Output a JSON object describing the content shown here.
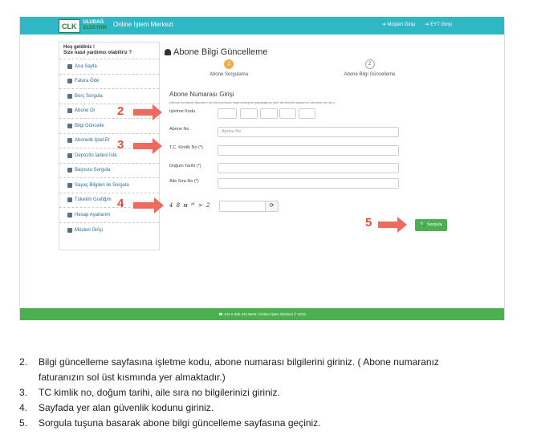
{
  "header": {
    "logo_short": "CLK",
    "logo_line1": "ULUDAĞ",
    "logo_line2": "ELEKTRİK",
    "site_title": "Online İşlem Merkezi",
    "link_customer": "Müşteri Girişi",
    "link_eyt": "EYT Girişi"
  },
  "sidebar": {
    "greeting": "Hoş geldiniz !",
    "greeting_sub": "Size nasıl yardımcı olabiliriz ?",
    "items": [
      {
        "label": "Ana Sayfa"
      },
      {
        "label": "Fatura Öde"
      },
      {
        "label": "Borç Sorgula"
      },
      {
        "label": "Abone Ol"
      },
      {
        "label": "Bilgi Güncelle"
      },
      {
        "label": "Abonelik İptal Et"
      },
      {
        "label": "Depozito İadesi İste"
      },
      {
        "label": "Başvuru Sorgula"
      },
      {
        "label": "Sayaç Bilgileri ile Sorgula"
      },
      {
        "label": "Tüketim Grafiğim"
      },
      {
        "label": "Hesap Ayarlarım"
      },
      {
        "label": "Müşteri Girişi"
      }
    ]
  },
  "main": {
    "title": "Abone Bilgi Güncelleme",
    "steps": [
      {
        "num": "1",
        "label": "Abone Sorgulama"
      },
      {
        "num": "2",
        "label": "Abone Bilgi Güncelleme"
      }
    ],
    "section_title": "Abone Numarası Girişi",
    "hint": "(Abone numarası faturanın sol üst kısmında veya sözleşme yapacağınız yere ait elektrik sayacının üzerinde yer alır.)",
    "fields": {
      "isletme_kodu": "İşletme Kodu",
      "abone_no": "Abone No",
      "abone_no_placeholder": "Abone No",
      "tc": "T.C. Kimlik No (*)",
      "dogum": "Doğum Tarihi (*)",
      "aile_sira": "Aile Sıra No (*)"
    },
    "captcha_text": "4 8 ᴍ ᴹ > 2",
    "refresh_icon": "⟳",
    "submit": "Sorgula"
  },
  "footer": "☎ 444 6 255 444 6646 | Online İşlem Merkezi © 2015",
  "annotations": [
    "2",
    "3",
    "4",
    "5"
  ],
  "instructions": [
    {
      "num": "2.",
      "text": "Bilgi güncelleme sayfasına işletme kodu, abone numarası bilgilerini giriniz. ( Abone numaranız"
    },
    {
      "num": "",
      "text": "faturanızın sol üst kısmında yer almaktadır.)"
    },
    {
      "num": "3.",
      "text": "TC kimlik no, doğum tarihi, aile sıra no bilgilerinizi giriniz."
    },
    {
      "num": "4.",
      "text": "Sayfada yer alan güvenlik kodunu giriniz."
    },
    {
      "num": "5.",
      "text": "Sorgula tuşuna basarak abone bilgi güncelleme sayfasına geçiniz."
    }
  ]
}
